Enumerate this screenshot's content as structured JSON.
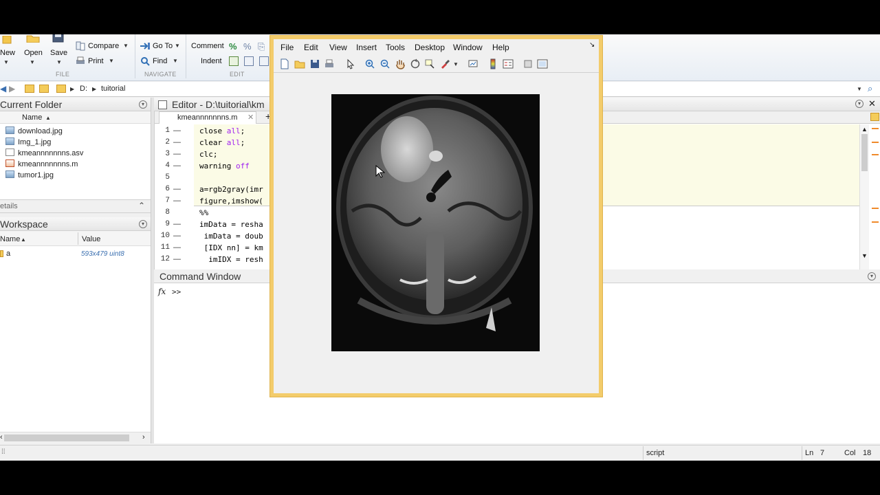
{
  "ribbon": {
    "new_label": "New",
    "open_label": "Open",
    "save_label": "Save",
    "compare_label": "Compare",
    "print_label": "Print",
    "goto_label": "Go To",
    "find_label": "Find",
    "comment_label": "Comment",
    "indent_label": "Indent",
    "sections": {
      "file": "FILE",
      "navigate": "NAVIGATE",
      "edit": "EDIT"
    }
  },
  "address": {
    "drive": "D:",
    "folder": "tuitorial"
  },
  "current_folder": {
    "title": "Current Folder",
    "col_name": "Name",
    "files": [
      "download.jpg",
      "Img_1.jpg",
      "kmeannnnnnns.asv",
      "kmeannnnnnns.m",
      "tumor1.jpg"
    ]
  },
  "details": {
    "title": "etails"
  },
  "workspace": {
    "title": "Workspace",
    "col_name": "Name",
    "col_value": "Value",
    "vars": [
      {
        "name": "a",
        "value": "593x479 uint8"
      }
    ]
  },
  "editor": {
    "title": "Editor - D:\\tuitorial\\km",
    "tab": "kmeannnnnnns.m",
    "lines": [
      {
        "n": "1",
        "dash": "—",
        "code": "close ",
        "str": "all",
        "rest": ";"
      },
      {
        "n": "2",
        "dash": "—",
        "code": "clear ",
        "str": "all",
        "rest": ";"
      },
      {
        "n": "3",
        "dash": "—",
        "code": "clc;",
        "str": "",
        "rest": ""
      },
      {
        "n": "4",
        "dash": "—",
        "code": "warning ",
        "str": "off",
        "rest": ""
      },
      {
        "n": "5",
        "dash": "",
        "code": "",
        "str": "",
        "rest": ""
      },
      {
        "n": "6",
        "dash": "—",
        "code": "a=rgb2gray(imr",
        "str": "",
        "rest": ""
      },
      {
        "n": "7",
        "dash": "—",
        "code": "figure,imshow(",
        "str": "",
        "rest": ""
      },
      {
        "n": "8",
        "dash": "",
        "code": "%%",
        "str": "",
        "rest": ""
      },
      {
        "n": "9",
        "dash": "—",
        "code": "imData = resha",
        "str": "",
        "rest": ""
      },
      {
        "n": "10",
        "dash": "—",
        "code": " imData = doub",
        "str": "",
        "rest": ""
      },
      {
        "n": "11",
        "dash": "—",
        "code": " [IDX nn] = km",
        "str": "",
        "rest": ""
      },
      {
        "n": "12",
        "dash": "—",
        "code": "  imIDX = resh",
        "str": "",
        "rest": ""
      }
    ]
  },
  "command_window": {
    "title": "Command Window",
    "fx": "fx",
    "prompt": ">>"
  },
  "figure": {
    "menus": [
      "File",
      "Edit",
      "View",
      "Insert",
      "Tools",
      "Desktop",
      "Window",
      "Help"
    ]
  },
  "status": {
    "mode": "script",
    "ln_label": "Ln",
    "ln": "7",
    "col_label": "Col",
    "col": "18"
  },
  "colors": {
    "figure_border": "#f3cc6b",
    "editor_highlight": "#fbfbe6",
    "string": "#a020f0",
    "link_value": "#3a6fb0"
  }
}
